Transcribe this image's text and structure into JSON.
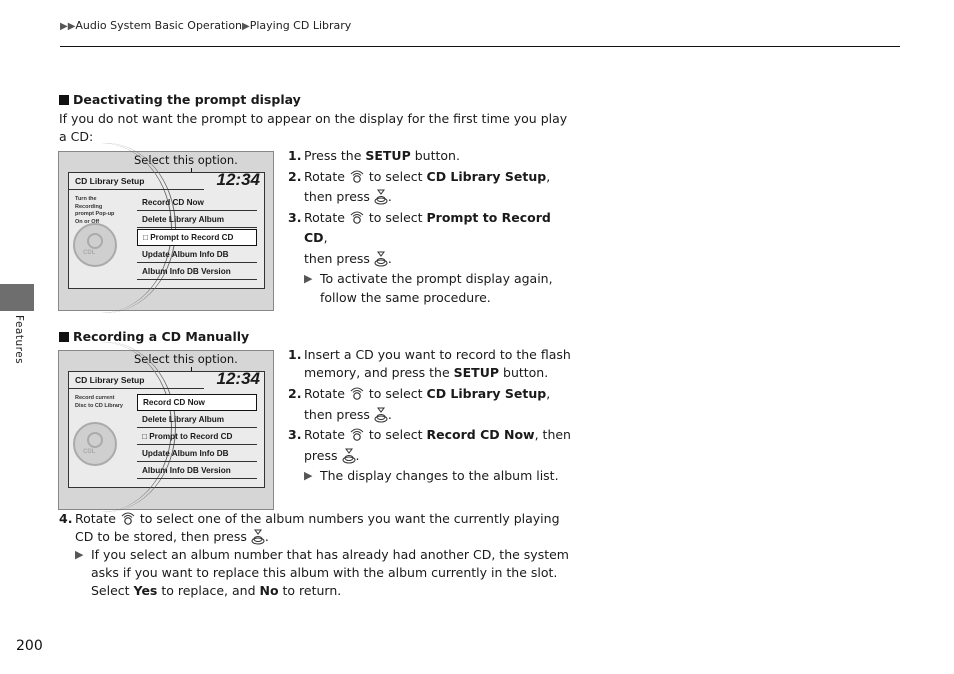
{
  "breadcrumb": {
    "prefix_icon": "double-triangle-right",
    "items": [
      "Audio System Basic Operation",
      "Playing CD Library"
    ]
  },
  "side_tab": {
    "label": "Features"
  },
  "page_number": "200",
  "section1": {
    "heading": "Deactivating the prompt display",
    "intro": "If you do not want the prompt to appear on the display for the first time you play a CD:",
    "figure": {
      "callout": "Select this option.",
      "screen_title": "CD Library Setup",
      "clock": "12:34",
      "description": "Turn the Recording prompt Pop-up On or Off",
      "disc_label": "CDL",
      "menu": [
        "Record CD Now",
        "Delete Library Album",
        "□ Prompt to Record CD",
        "Update Album Info DB",
        "Album Info DB Version"
      ],
      "highlighted_index": 2
    },
    "steps": [
      {
        "num": "1.",
        "pre": "Press the ",
        "bold": "SETUP",
        "post": " button."
      },
      {
        "num": "2.",
        "pre": "Rotate ",
        "mid": " to select ",
        "bold": "CD Library Setup",
        "post": ",",
        "line2": "then press "
      },
      {
        "num": "3.",
        "pre": "Rotate ",
        "mid": " to select ",
        "bold": "Prompt to Record CD",
        "post": ",",
        "line2": "then press "
      }
    ],
    "note": "To activate the prompt display again, follow the same procedure."
  },
  "section2": {
    "heading": "Recording a CD Manually",
    "figure": {
      "callout": "Select this option.",
      "screen_title": "CD Library Setup",
      "clock": "12:34",
      "description": "Record current Disc to CD Library",
      "disc_label": "CDL",
      "menu": [
        "Record CD Now",
        "Delete Library Album",
        "□ Prompt to Record CD",
        "Update Album Info DB",
        "Album Info DB Version"
      ],
      "highlighted_index": 0
    },
    "steps": [
      {
        "num": "1.",
        "pre": "Insert a CD you want to record to the flash memory, and press the ",
        "bold": "SETUP",
        "post": " button."
      },
      {
        "num": "2.",
        "pre": "Rotate ",
        "mid": " to select ",
        "bold": "CD Library Setup",
        "post": ",",
        "line2": "then press "
      },
      {
        "num": "3.",
        "pre": "Rotate ",
        "mid": " to select ",
        "bold": "Record CD Now",
        "post": ", then",
        "line2": "press "
      }
    ],
    "note": "The display changes to the album list.",
    "step4": {
      "num": "4.",
      "pre": "Rotate ",
      "text": " to select one of the album numbers you want the currently playing CD to be stored, then press ",
      "note_pre": "If you select an album number that has already had another CD, the system asks if you want to replace this album with the album currently in the slot. Select ",
      "yes": "Yes",
      "note_mid": " to replace, and ",
      "no": "No",
      "note_post": " to return."
    }
  }
}
